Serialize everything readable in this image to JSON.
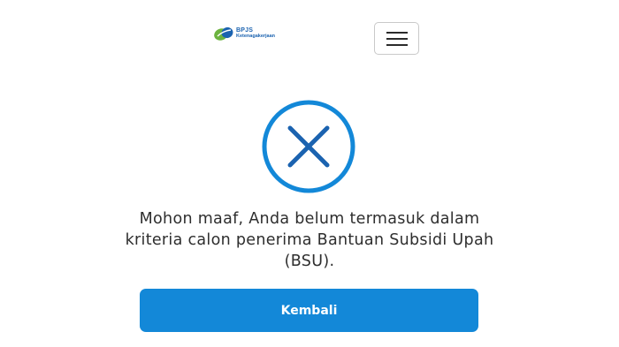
{
  "header": {
    "logo": {
      "brand": "BPJS",
      "subtitle": "Ketenagakerjaan",
      "colors": {
        "green": "#6cb33f",
        "blue": "#1b63b0"
      }
    },
    "menu_icon": "hamburger-menu-icon"
  },
  "status": {
    "icon": "close-circle-icon",
    "color": "#1388d8",
    "message": "Mohon maaf, Anda belum termasuk dalam kriteria calon penerima Bantuan Subsidi Upah (BSU)."
  },
  "actions": {
    "back_label": "Kembali",
    "button_color": "#1388d8"
  }
}
